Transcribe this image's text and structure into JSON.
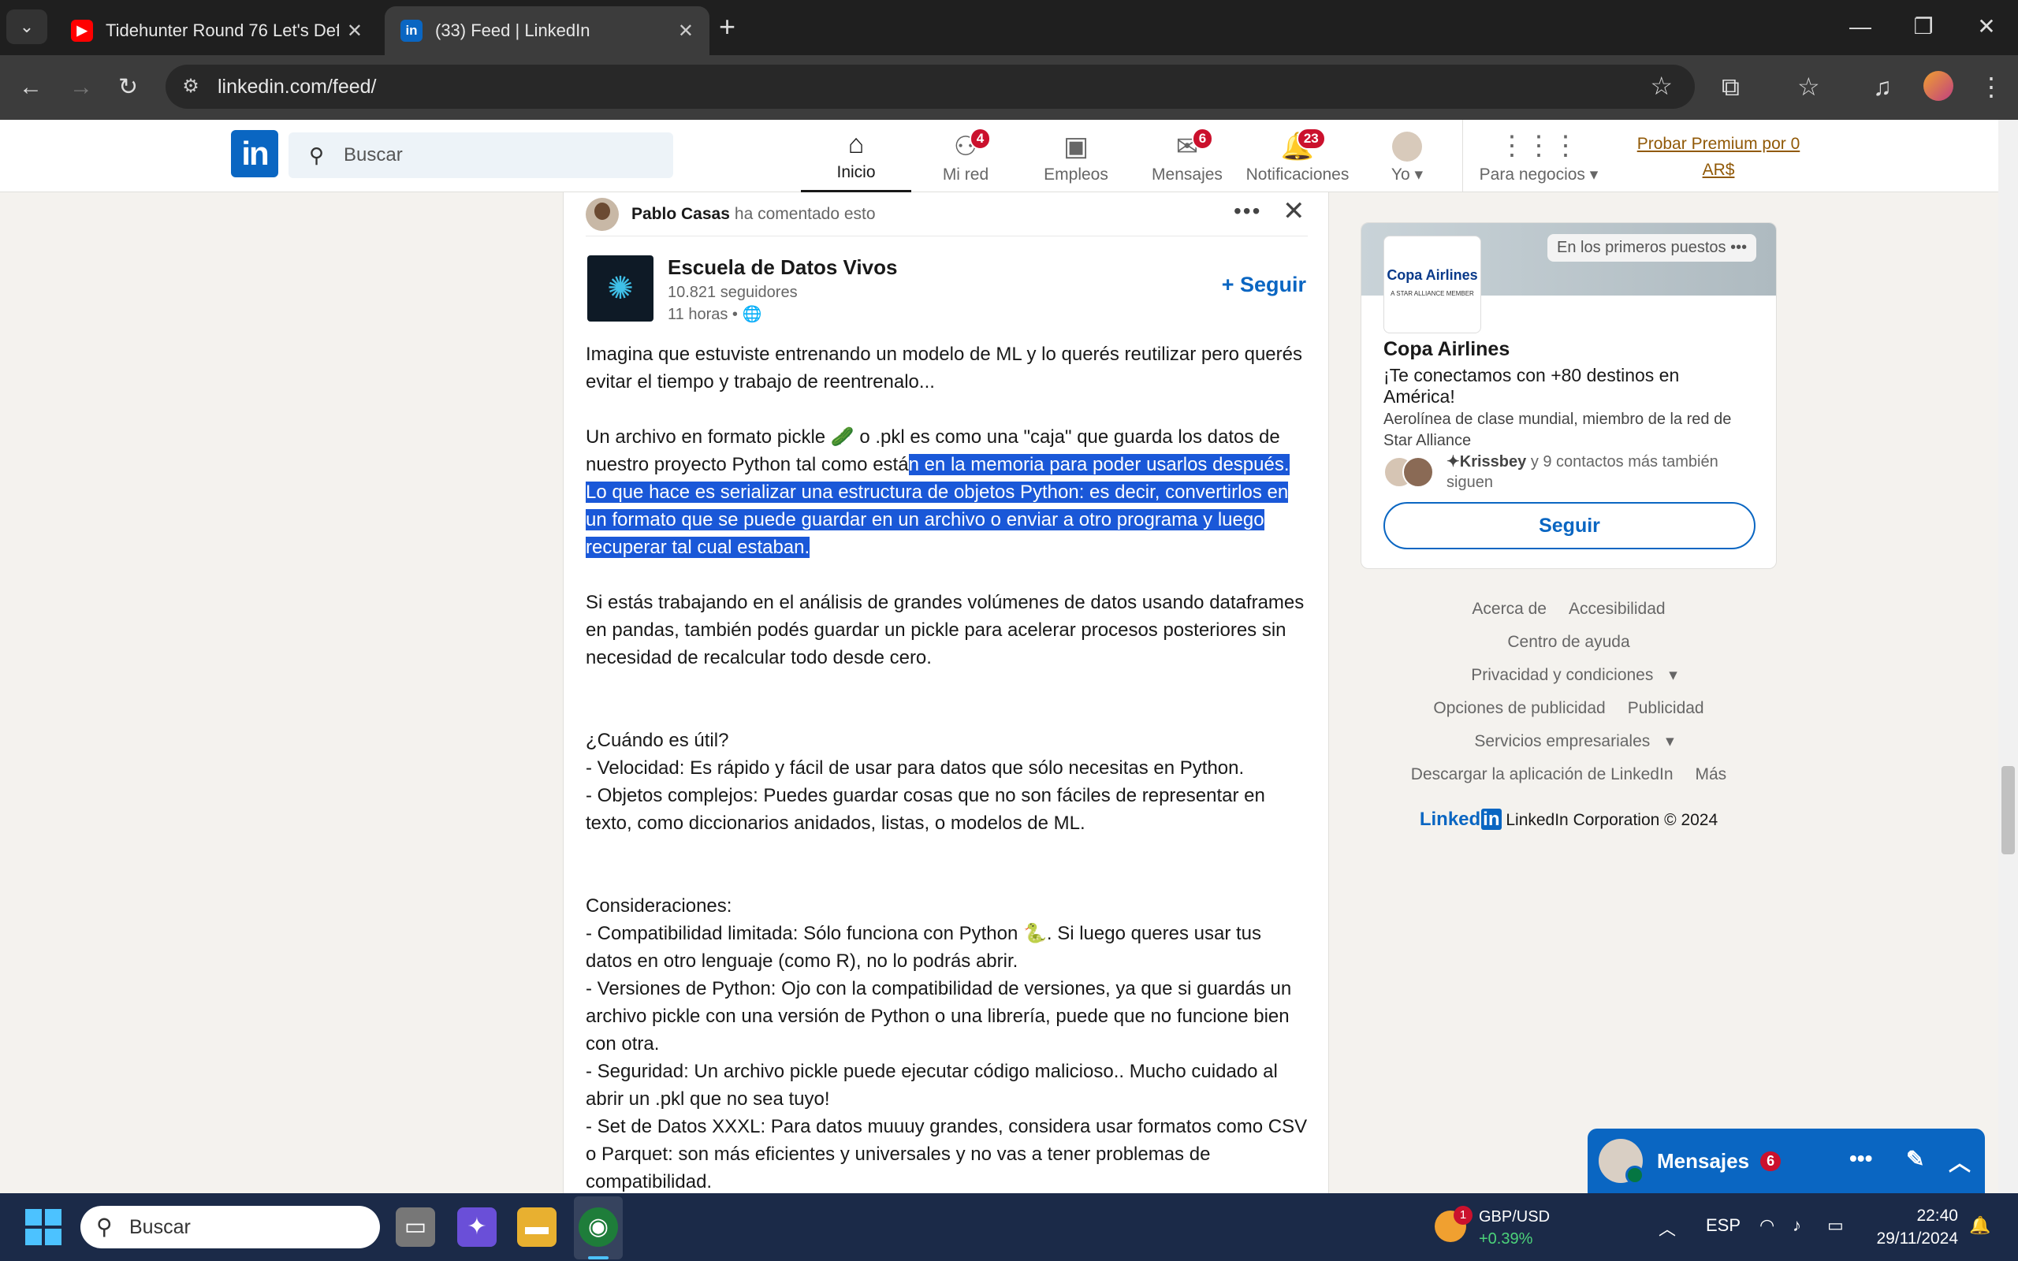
{
  "browser": {
    "tabs": [
      {
        "title": "Tidehunter Round 76 Let's Defe",
        "active": false,
        "icon": "youtube-icon"
      },
      {
        "title": "(33) Feed | LinkedIn",
        "active": true,
        "icon": "linkedin-icon"
      }
    ],
    "url": "linkedin.com/feed/"
  },
  "linkedin": {
    "logo": "in",
    "search_placeholder": "Buscar",
    "nav": [
      {
        "label": "Inicio",
        "icon": "home-icon",
        "badge": null,
        "active": true
      },
      {
        "label": "Mi red",
        "icon": "people-icon",
        "badge": "4"
      },
      {
        "label": "Empleos",
        "icon": "briefcase-icon",
        "badge": null
      },
      {
        "label": "Mensajes",
        "icon": "chat-icon",
        "badge": "6"
      },
      {
        "label": "Notificaciones",
        "icon": "bell-icon",
        "badge": "23"
      },
      {
        "label": "Yo",
        "icon": "avatar",
        "badge": null
      },
      {
        "label": "Para negocios",
        "icon": "grid-icon",
        "badge": null
      }
    ],
    "premium_line1": "Probar Premium por 0",
    "premium_line2": "AR$"
  },
  "post": {
    "commenter_name": "Pablo Casas",
    "commenter_action": "ha comentado esto",
    "org_name": "Escuela de Datos Vivos",
    "followers": "10.821 seguidores",
    "time": "11 horas •",
    "follow_label": "+ Seguir",
    "p1": "Imagina que estuviste entrenando un modelo de ML y lo querés reutilizar pero querés evitar el tiempo y trabajo de reentrenalo...",
    "p2_plain": "Un archivo en formato pickle 🥒 o .pkl es como una \"caja\" que guarda los datos de nuestro proyecto Python tal como está",
    "p2_selected": "n en la memoria para poder usarlos después. Lo que hace es serializar una estructura de objetos Python: es decir, convertirlos en un formato que se puede guardar en un archivo o enviar a otro programa y luego recuperar tal cual estaban.",
    "p3": "Si estás trabajando en el análisis de grandes volúmenes de datos usando dataframes en pandas, también podés guardar un pickle para acelerar procesos posteriores sin necesidad de recalcular todo desde cero.",
    "when_title": "¿Cuándo es útil?",
    "when_1": "- Velocidad: Es rápido y fácil de usar para datos que sólo necesitas en Python.",
    "when_2": "- Objetos complejos: Puedes guardar cosas que no son fáciles de representar en texto, como diccionarios anidados, listas, o modelos de ML.",
    "cons_title": "Consideraciones:",
    "cons_1": "- Compatibilidad limitada: Sólo funciona con Python 🐍. Si luego queres usar tus datos en otro lenguaje (como R), no lo podrás abrir.",
    "cons_2": "- Versiones de Python: Ojo con la compatibilidad de versiones, ya que si guardás un archivo pickle con una versión de Python o una librería, puede que no funcione bien con otra.",
    "cons_3": "- Seguridad: Un archivo pickle puede ejecutar código malicioso.. Mucho cuidado al abrir un .pkl que no sea tuyo!",
    "cons_4": "- Set de Datos XXXL: Para datos muuuy grandes, considera usar formatos como CSV o Parquet: son más eficientes y universales y no vas a tener problemas de compatibilidad."
  },
  "ad": {
    "logo_text": "Copa Airlines",
    "logo_sub": "A STAR ALLIANCE MEMBER",
    "tag": "En los primeros puestos",
    "name": "Copa Airlines",
    "headline": "¡Te conectamos con +80 destinos en América!",
    "description": "Aerolínea de clase mundial, miembro de la red de Star Alliance",
    "connections_name": "✦Krissbey",
    "connections_rest": "y 9 contactos más también siguen",
    "follow": "Seguir"
  },
  "footer": {
    "links": [
      "Acerca de",
      "Accesibilidad",
      "Centro de ayuda",
      "Privacidad y condiciones",
      "Opciones de publicidad",
      "Publicidad",
      "Servicios empresariales",
      "Descargar la aplicación de LinkedIn",
      "Más"
    ],
    "brand": "Linked",
    "brand_in": "in",
    "copyright": "LinkedIn Corporation © 2024"
  },
  "messaging": {
    "label": "Mensajes",
    "badge": "6"
  },
  "taskbar": {
    "search": "Buscar",
    "forex_pair": "GBP/USD",
    "forex_change": "+0.39%",
    "forex_badge": "1",
    "lang": "ESP",
    "time": "22:40",
    "date": "29/11/2024"
  }
}
